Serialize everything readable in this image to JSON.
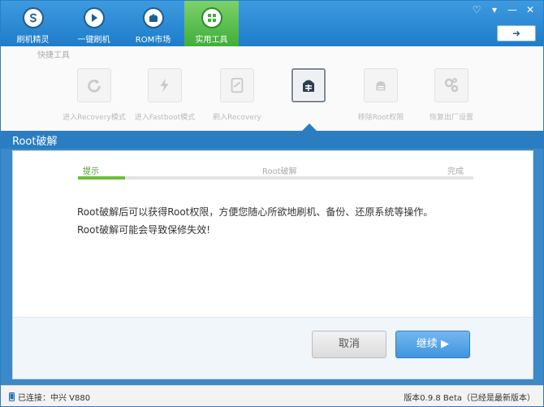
{
  "nav": {
    "items": [
      {
        "label": "刷机精灵",
        "icon": "logo-icon"
      },
      {
        "label": "一键刷机",
        "icon": "play-icon"
      },
      {
        "label": "ROM市场",
        "icon": "android-icon"
      },
      {
        "label": "实用工具",
        "icon": "grid-icon"
      }
    ],
    "active": "实用工具"
  },
  "window_controls": {
    "feedback": "♡",
    "settings": "▾",
    "minimize": "—",
    "close": "✕",
    "menu": "➜"
  },
  "tools": {
    "title": "快捷工具",
    "items": [
      {
        "label": "进入Recovery模式",
        "icon": "refresh-icon"
      },
      {
        "label": "进入Fastboot模式",
        "icon": "lightning-icon"
      },
      {
        "label": "刷入Recovery",
        "icon": "tablet-icon"
      },
      {
        "label": "",
        "icon": "android-lock-icon"
      },
      {
        "label": "移除Root权限",
        "icon": "android-icon"
      },
      {
        "label": "恢复出厂设置",
        "icon": "gears-icon"
      }
    ]
  },
  "section": {
    "title": "Root破解"
  },
  "steps": {
    "items": [
      "提示",
      "Root破解",
      "完成"
    ],
    "current": 0,
    "progress": 0.12
  },
  "message": {
    "line1": "Root破解后可以获得Root权限，方便您随心所欲地刷机、备份、还原系统等操作。",
    "line2": "Root破解可能会导致保修失效!"
  },
  "buttons": {
    "cancel": "取消",
    "next": "继续 ▶"
  },
  "status": {
    "connection": "已连接：中兴 V880",
    "version": "版本0.9.8 Beta（已经是最新版本）"
  },
  "colors": {
    "accent": "#2b7dc2",
    "active_nav": "#3fae3a",
    "progress": "#6fbd3d"
  }
}
